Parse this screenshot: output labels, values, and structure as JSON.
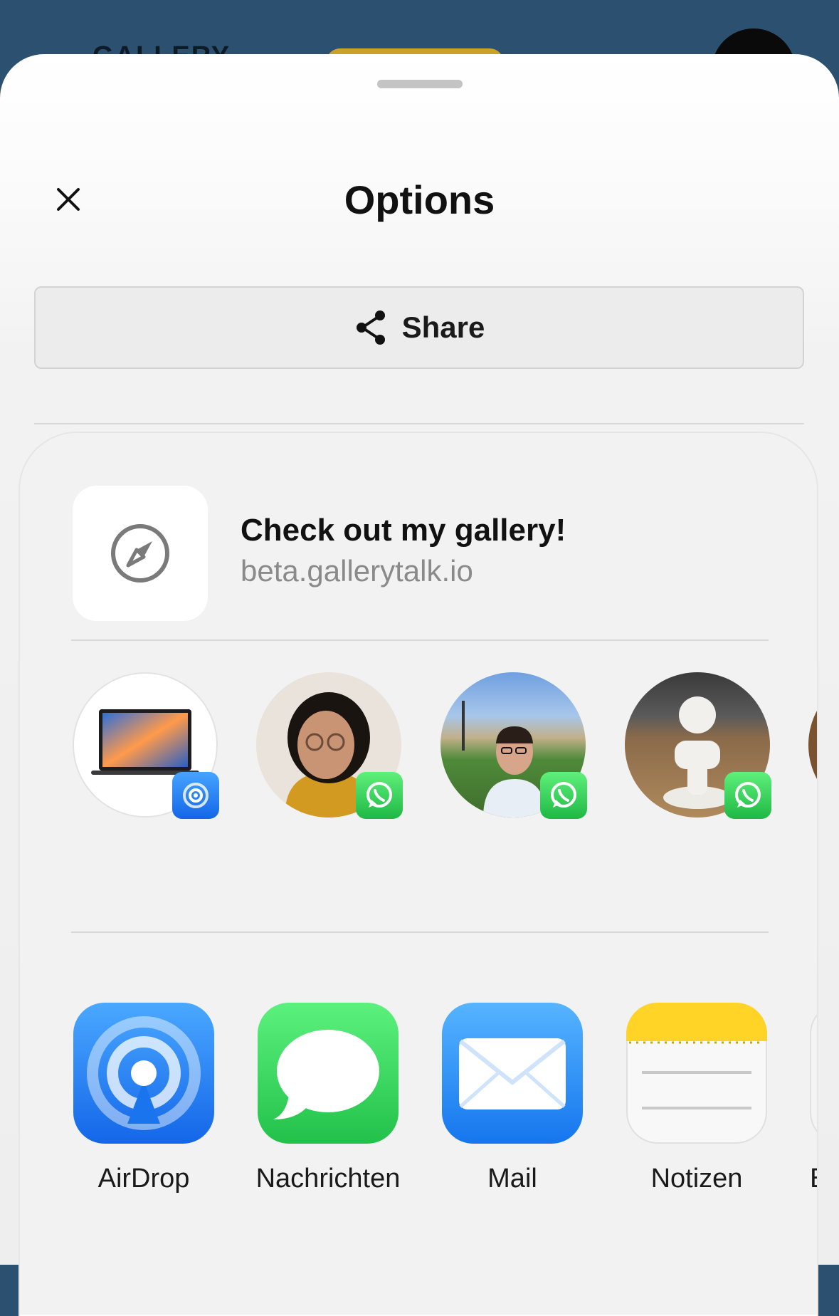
{
  "background": {
    "title": "GALLERY"
  },
  "sheet": {
    "title": "Options",
    "close_icon": "close-icon",
    "share_label": "Share",
    "share_icon": "share-icon"
  },
  "share_sheet": {
    "preview": {
      "title": "Check out my gallery!",
      "url": "beta.gallerytalk.io",
      "icon": "compass-icon"
    },
    "contacts": [
      {
        "kind": "laptop",
        "badge": "airdrop-badge-icon"
      },
      {
        "kind": "person",
        "badge": "whatsapp-badge-icon"
      },
      {
        "kind": "person",
        "badge": "whatsapp-badge-icon"
      },
      {
        "kind": "figurine",
        "badge": "whatsapp-badge-icon"
      }
    ],
    "apps": [
      {
        "label": "AirDrop",
        "icon": "airdrop-icon",
        "color": "#1a7cf5"
      },
      {
        "label": "Nachrichten",
        "icon": "messages-icon",
        "color": "#34c759"
      },
      {
        "label": "Mail",
        "icon": "mail-icon",
        "color": "#1e88f5"
      },
      {
        "label": "Notizen",
        "icon": "notes-icon",
        "color": "#ffd426"
      },
      {
        "label": "Er"
      }
    ]
  },
  "colors": {
    "background_bar": "#2c5170",
    "accent_pill": "#c9a227"
  }
}
